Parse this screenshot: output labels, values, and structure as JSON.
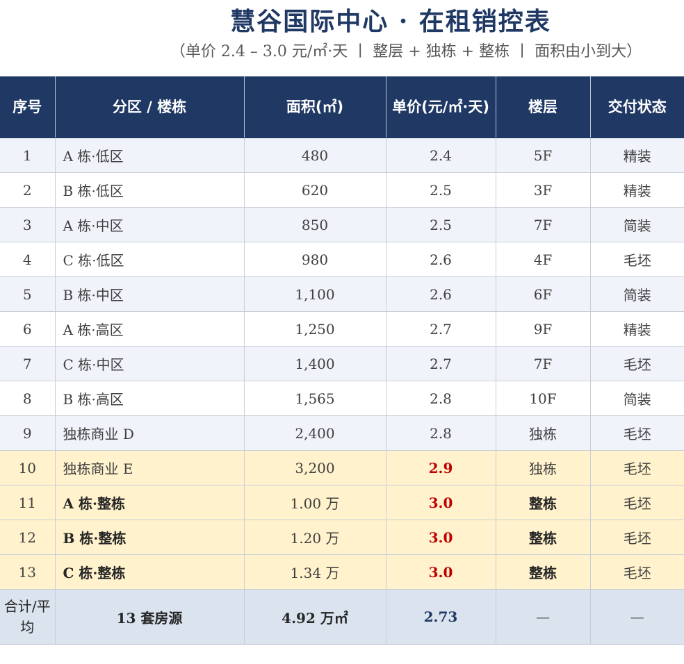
{
  "title": "慧谷国际中心 · 在租销控表",
  "subtitle": "（单价 2.4 – 3.0 元/㎡·天 丨 整层 + 独栋 + 整栋 丨 面积由小到大）",
  "headers": [
    "序号",
    "分区 / 楼栋",
    "面积(㎡)",
    "单价(元/㎡·天)",
    "楼层",
    "交付状态"
  ],
  "rows": [
    {
      "no": "1",
      "zone": "A 栋·低区",
      "area": "480",
      "price": "2.4",
      "floor": "5F",
      "status": "精装"
    },
    {
      "no": "2",
      "zone": "B 栋·低区",
      "area": "620",
      "price": "2.5",
      "floor": "3F",
      "status": "精装"
    },
    {
      "no": "3",
      "zone": "A 栋·中区",
      "area": "850",
      "price": "2.5",
      "floor": "7F",
      "status": "简装"
    },
    {
      "no": "4",
      "zone": "C 栋·低区",
      "area": "980",
      "price": "2.6",
      "floor": "4F",
      "status": "毛坯"
    },
    {
      "no": "5",
      "zone": "B 栋·中区",
      "area": "1,100",
      "price": "2.6",
      "floor": "6F",
      "status": "简装"
    },
    {
      "no": "6",
      "zone": "A 栋·高区",
      "area": "1,250",
      "price": "2.7",
      "floor": "9F",
      "status": "精装"
    },
    {
      "no": "7",
      "zone": "C 栋·中区",
      "area": "1,400",
      "price": "2.7",
      "floor": "7F",
      "status": "毛坯"
    },
    {
      "no": "8",
      "zone": "B 栋·高区",
      "area": "1,565",
      "price": "2.8",
      "floor": "10F",
      "status": "简装"
    },
    {
      "no": "9",
      "zone": "独栋商业 D",
      "area": "2,400",
      "price": "2.8",
      "floor": "独栋",
      "status": "毛坯"
    },
    {
      "no": "10",
      "zone": "独栋商业 E",
      "area": "3,200",
      "price": "2.9",
      "floor": "独栋",
      "status": "毛坯"
    },
    {
      "no": "11",
      "zone": "A 栋·整栋",
      "area": "1.00 万",
      "price": "3.0",
      "floor": "整栋",
      "status": "毛坯"
    },
    {
      "no": "12",
      "zone": "B 栋·整栋",
      "area": "1.20 万",
      "price": "3.0",
      "floor": "整栋",
      "status": "毛坯"
    },
    {
      "no": "13",
      "zone": "C 栋·整栋",
      "area": "1.34 万",
      "price": "3.0",
      "floor": "整栋",
      "status": "毛坯"
    }
  ],
  "total": {
    "label": "合计/平均",
    "count": "13 套房源",
    "area": "4.92 万㎡",
    "price": "2.73",
    "floor": "—",
    "status": "—"
  },
  "colors": {
    "header_bg": "#1f3864",
    "highlight_bg": "#fff2cc",
    "stripe_bg": "#f0f3fa",
    "total_bg": "#dae3ee",
    "accent_red": "#c00000"
  }
}
